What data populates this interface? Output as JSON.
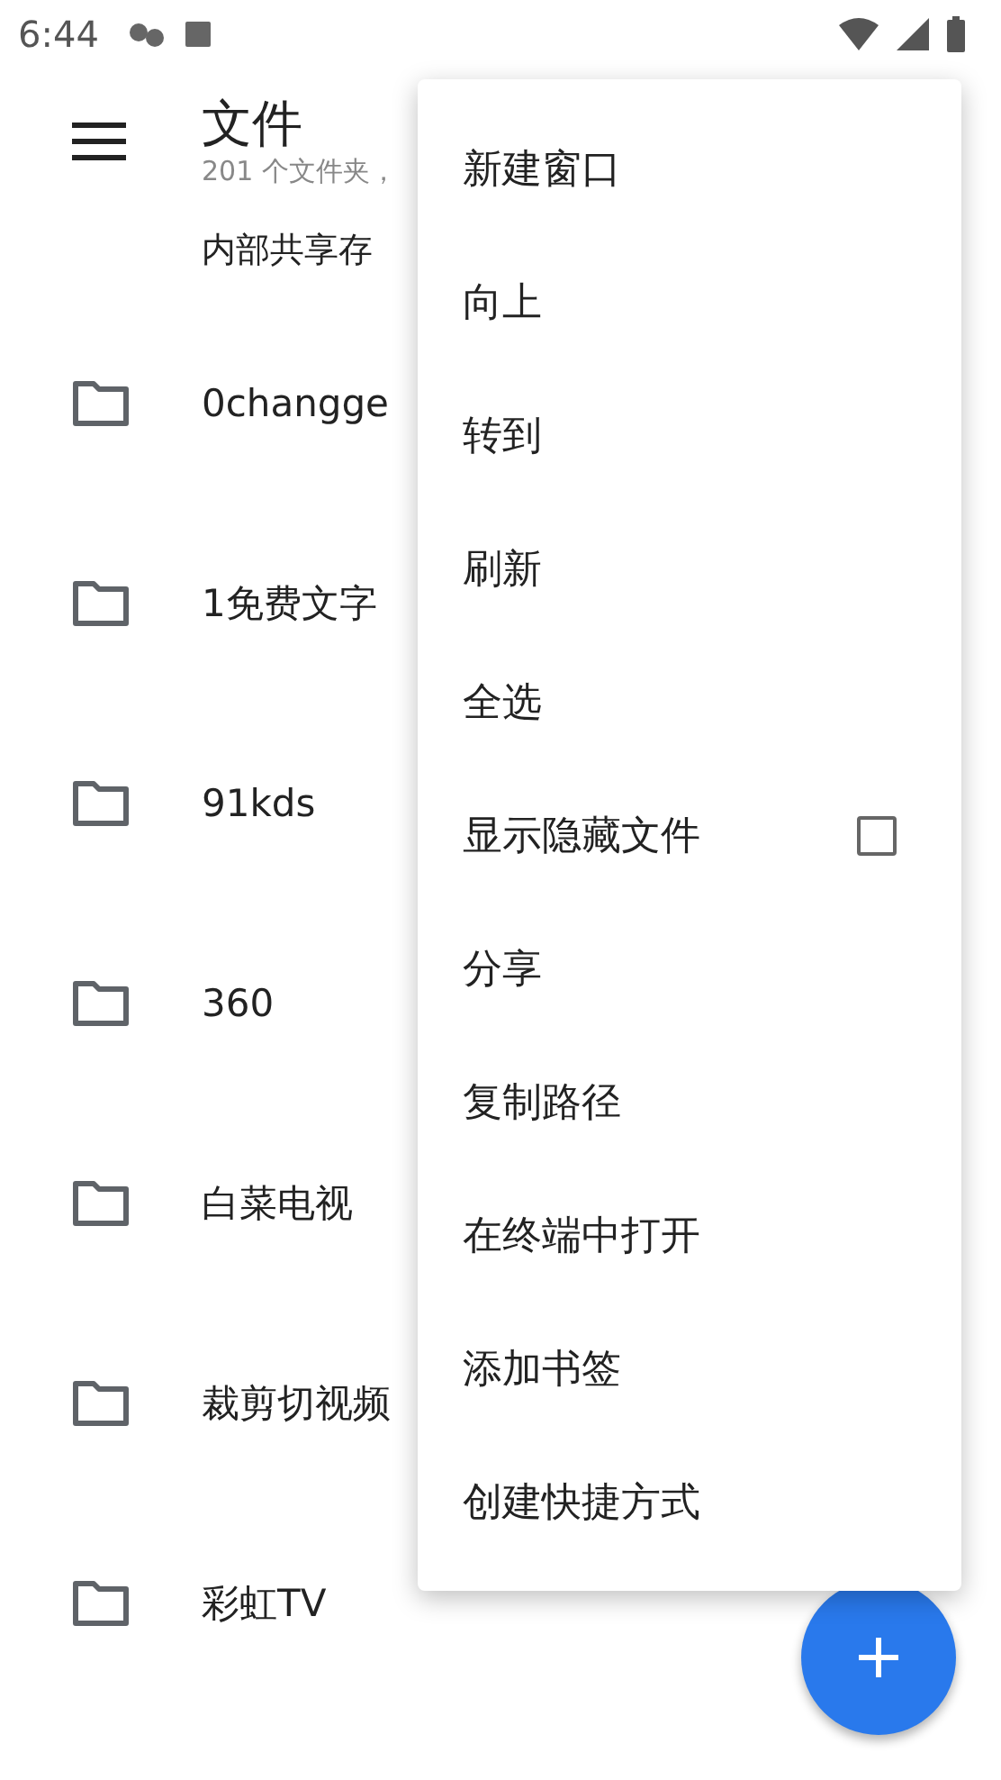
{
  "status_bar": {
    "time": "6:44"
  },
  "app_bar": {
    "title": "文件",
    "subtitle": "201 个文件夹，"
  },
  "breadcrumb": "内部共享存",
  "folders": [
    {
      "name": "0changge"
    },
    {
      "name": "1免费文字"
    },
    {
      "name": "91kds"
    },
    {
      "name": "360"
    },
    {
      "name": "白菜电视"
    },
    {
      "name": "裁剪切视频"
    },
    {
      "name": "彩虹TV"
    }
  ],
  "menu": [
    {
      "label": "新建窗口",
      "kind": "plain"
    },
    {
      "label": "向上",
      "kind": "plain"
    },
    {
      "label": "转到",
      "kind": "plain"
    },
    {
      "label": "刷新",
      "kind": "plain"
    },
    {
      "label": "全选",
      "kind": "plain"
    },
    {
      "label": "显示隐藏文件",
      "kind": "checkbox",
      "checked": false
    },
    {
      "label": "分享",
      "kind": "plain"
    },
    {
      "label": "复制路径",
      "kind": "plain"
    },
    {
      "label": "在终端中打开",
      "kind": "plain"
    },
    {
      "label": "添加书签",
      "kind": "plain"
    },
    {
      "label": "创建快捷方式",
      "kind": "plain"
    }
  ]
}
